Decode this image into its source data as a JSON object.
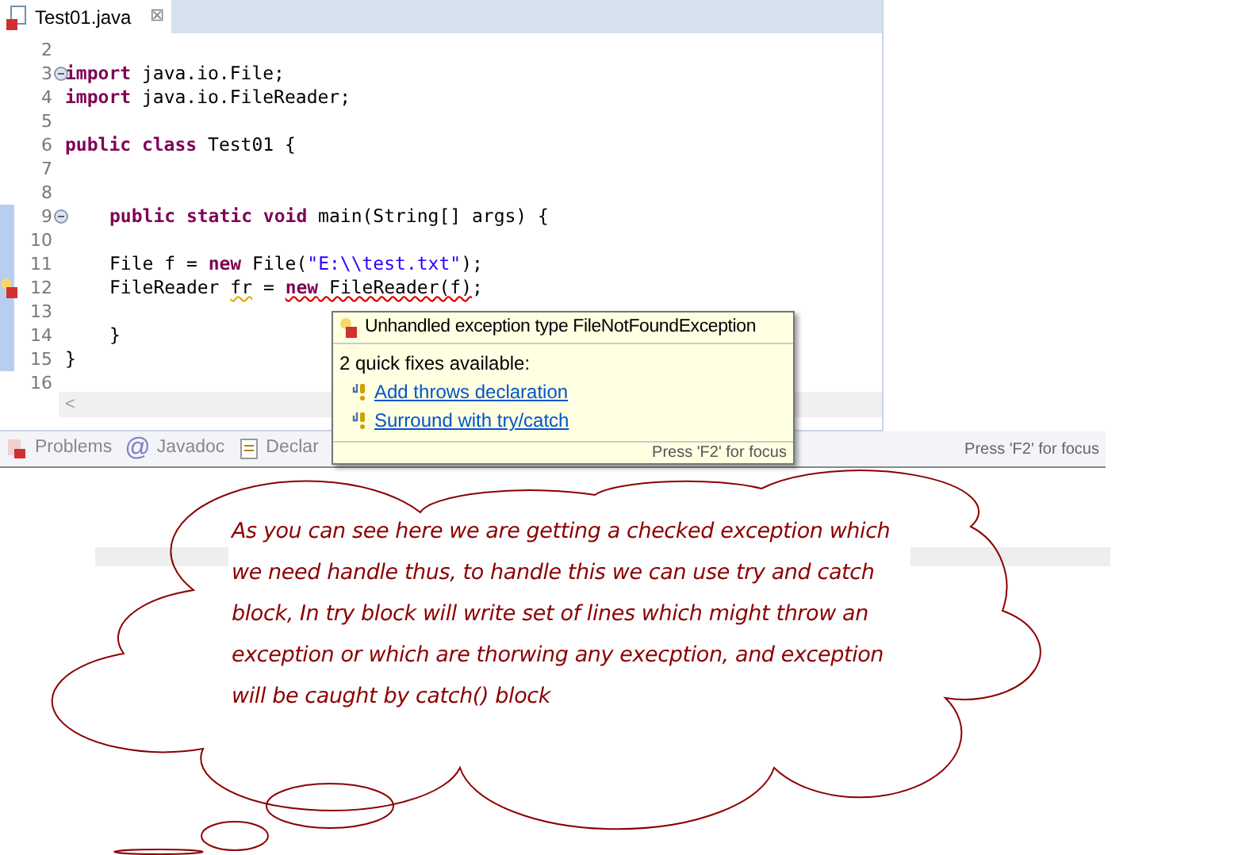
{
  "editor_tab": {
    "title": "Test01.java",
    "close": "⊠",
    "selected": true
  },
  "code_lines": [
    {
      "number": "2",
      "fold": false,
      "error": false,
      "changed": false,
      "indented": false
    },
    {
      "number": "3",
      "fold": true,
      "error": false,
      "changed": false,
      "indented": false,
      "tokens": [
        {
          "kind": "keyword",
          "text": "import"
        },
        {
          "kind": "plain",
          "text": " java.io.File;"
        }
      ]
    },
    {
      "number": "4",
      "fold": false,
      "error": false,
      "changed": false,
      "indented": false,
      "tokens": [
        {
          "kind": "keyword",
          "text": "import"
        },
        {
          "kind": "plain",
          "text": " java.io.FileReader;"
        }
      ]
    },
    {
      "number": "5",
      "fold": false,
      "error": false,
      "changed": false,
      "indented": false
    },
    {
      "number": "6",
      "fold": false,
      "error": false,
      "changed": false,
      "indented": false,
      "tokens": [
        {
          "kind": "keyword",
          "text": "public class"
        },
        {
          "kind": "plain",
          "text": " Test01 {"
        }
      ]
    },
    {
      "number": "7",
      "fold": false,
      "error": false,
      "changed": false,
      "indented": false
    },
    {
      "number": "8",
      "fold": false,
      "error": false,
      "changed": false,
      "indented": false
    },
    {
      "number": "9",
      "fold": true,
      "error": false,
      "changed": true,
      "indented": true,
      "tokens": [
        {
          "kind": "keyword",
          "text": "public static void"
        },
        {
          "kind": "plain",
          "text": " main(String[] args) {"
        }
      ]
    },
    {
      "number": "10",
      "fold": false,
      "error": false,
      "changed": true,
      "indented": false
    },
    {
      "number": "11",
      "fold": false,
      "error": false,
      "changed": true,
      "indented": true,
      "tokens": [
        {
          "kind": "plain",
          "text": "File f = "
        },
        {
          "kind": "keyword",
          "text": "new"
        },
        {
          "kind": "plain",
          "text": " File("
        },
        {
          "kind": "string",
          "text": "\"E:\\\\test.txt\""
        },
        {
          "kind": "plain",
          "text": ");"
        }
      ]
    },
    {
      "number": "12",
      "fold": false,
      "error": true,
      "changed": true,
      "indented": true,
      "tokens": [
        {
          "kind": "plain",
          "text": "FileReader "
        },
        {
          "kind": "warning",
          "text": "fr"
        },
        {
          "kind": "plain",
          "text": " = "
        },
        {
          "kind": "error_keyword",
          "text": "new"
        },
        {
          "kind": "error",
          "text": " FileReader(f)"
        },
        {
          "kind": "plain",
          "text": ";"
        }
      ]
    },
    {
      "number": "13",
      "fold": false,
      "error": false,
      "changed": true,
      "indented": false
    },
    {
      "number": "14",
      "fold": false,
      "error": false,
      "changed": true,
      "indented": true,
      "tokens": [
        {
          "kind": "plain",
          "text": "}"
        }
      ]
    },
    {
      "number": "15",
      "fold": false,
      "error": false,
      "changed": true,
      "indented": false,
      "tokens": [
        {
          "kind": "plain",
          "text": "}"
        }
      ]
    },
    {
      "number": "16",
      "fold": false,
      "error": false,
      "changed": false,
      "indented": false
    }
  ],
  "scroll_left": "<",
  "bottom_tabs": [
    {
      "label": "Problems",
      "kind": "problems"
    },
    {
      "label": "Javadoc",
      "kind": "javadoc",
      "icon": "@"
    },
    {
      "label": "Declar",
      "kind": "declaration"
    }
  ],
  "back_hint": "Press 'F2' for focus",
  "quick_fix_popup": {
    "title": "Unhandled exception type FileNotFoundException",
    "subtitle": "2 quick fixes available:",
    "fixes": [
      "Add throws declaration",
      "Surround with try/catch"
    ],
    "hint": "Press 'F2' for focus"
  },
  "callout": "As you can see here we are getting a checked exception which we need handle thus, to handle this we can use try and catch block, In try block will write set of lines which might throw an exception or which are thorwing any execption, and exception will be caught by catch() block"
}
